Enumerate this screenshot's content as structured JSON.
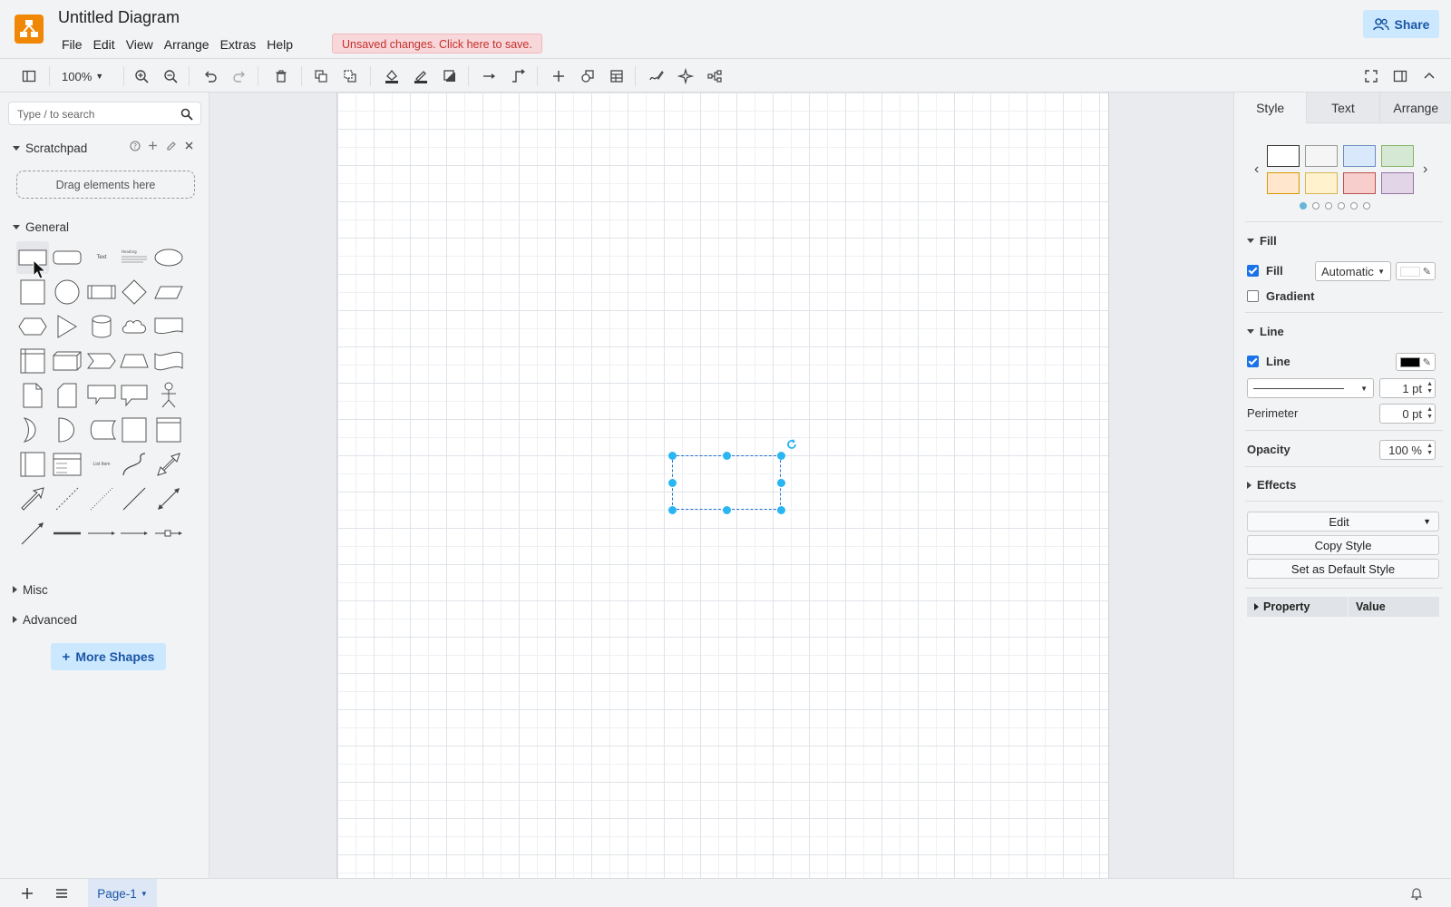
{
  "app": {
    "doc_title": "Untitled Diagram",
    "menu": [
      "File",
      "Edit",
      "View",
      "Arrange",
      "Extras",
      "Help"
    ],
    "unsaved_notice": "Unsaved changes. Click here to save.",
    "share_label": "Share",
    "accent_color": "#f08705"
  },
  "toolbar": {
    "zoom": "100%"
  },
  "sidebar": {
    "search_placeholder": "Type / to search",
    "scratchpad_title": "Scratchpad",
    "dropzone_label": "Drag elements here",
    "general_title": "General",
    "misc_title": "Misc",
    "advanced_title": "Advanced",
    "more_shapes_label": "More Shapes",
    "shape_text_label": "Text",
    "shape_heading_label": "Heading",
    "shape_list_label": "List Item"
  },
  "format_panel": {
    "tabs": [
      "Style",
      "Text",
      "Arrange"
    ],
    "swatches": [
      "#ffffff",
      "#f5f5f5",
      "#dae8fc",
      "#d5e8d4",
      "#ffe6cc",
      "#fff2cc",
      "#f8cecc",
      "#e1d5e7"
    ],
    "fill_section": "Fill",
    "fill_label": "Fill",
    "fill_value": "Automatic",
    "gradient_label": "Gradient",
    "line_section": "Line",
    "line_label": "Line",
    "line_width": "1 pt",
    "perimeter_label": "Perimeter",
    "perimeter_value": "0 pt",
    "opacity_label": "Opacity",
    "opacity_value": "100 %",
    "effects_section": "Effects",
    "edit_label": "Edit",
    "copy_style_label": "Copy Style",
    "default_style_label": "Set as Default Style",
    "property_col": "Property",
    "value_col": "Value"
  },
  "footer": {
    "page_tab": "Page-1"
  }
}
